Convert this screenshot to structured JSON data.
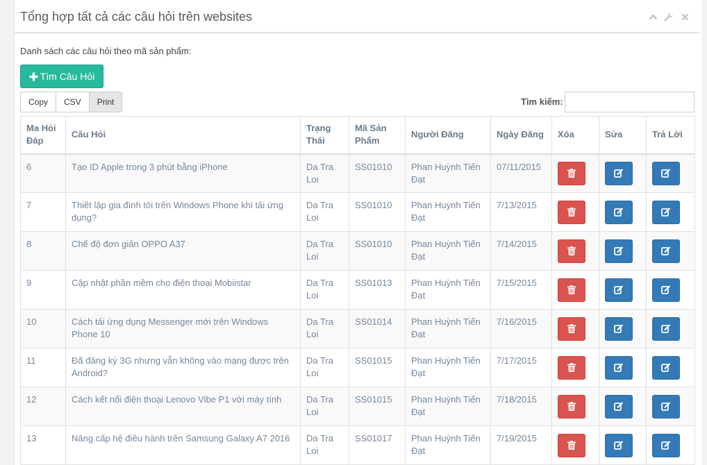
{
  "panel": {
    "title": "Tổng hợp tất cả các câu hỏi trên websites",
    "tools": [
      {
        "icon": "chevron-up-icon",
        "glyph": "⌃"
      },
      {
        "icon": "wrench-icon",
        "glyph": "🔧"
      },
      {
        "icon": "close-icon",
        "glyph": "✕"
      }
    ]
  },
  "subtitle": "Danh sách các câu hỏi theo mã sản phẩm:",
  "find_button": {
    "icon": "plus-icon",
    "label": "Tìm Câu Hỏi"
  },
  "export_buttons": [
    "Copy",
    "CSV",
    "Print"
  ],
  "search": {
    "label": "Tìm kiếm:",
    "value": ""
  },
  "table": {
    "columns": [
      "Ma Hỏi Đáp",
      "Câu Hỏi",
      "Trạng Thái",
      "Mã Sản Phẩm",
      "Người Đăng",
      "Ngày Đăng",
      "Xóa",
      "Sửa",
      "Trả Lời"
    ],
    "rows": [
      {
        "id": "6",
        "question": "Tạo ID Apple trong 3 phút bằng iPhone",
        "status": "Da Tra Loi",
        "product": "SS01010",
        "author": "Phan Huỳnh Tiến Đạt",
        "date": "07/11/2015"
      },
      {
        "id": "7",
        "question": "Thiết lập gia đình tôi trên Windows Phone khi tải ứng dụng?",
        "status": "Da Tra Loi",
        "product": "SS01010",
        "author": "Phan Huỳnh Tiến Đạt",
        "date": "7/13/2015"
      },
      {
        "id": "8",
        "question": "Chế độ đơn giản OPPO A37",
        "status": "Da Tra Loi",
        "product": "SS01010",
        "author": "Phan Huỳnh Tiến Đạt",
        "date": "7/14/2015"
      },
      {
        "id": "9",
        "question": "Cập nhật phần mềm cho điện thoại Mobiistar",
        "status": "Da Tra Loi",
        "product": "SS01013",
        "author": "Phan Huỳnh Tiến Đạt",
        "date": "7/15/2015"
      },
      {
        "id": "10",
        "question": "Cách tải ứng dụng Messenger mới trên Windows Phone 10",
        "status": "Da Tra Loi",
        "product": "SS01014",
        "author": "Phan Huỳnh Tiến Đạt",
        "date": "7/16/2015"
      },
      {
        "id": "11",
        "question": "Đã đăng ký 3G nhưng vẫn không vào mạng được trên Android?",
        "status": "Da Tra Loi",
        "product": "SS01015",
        "author": "Phan Huỳnh Tiến Đạt",
        "date": "7/17/2015"
      },
      {
        "id": "12",
        "question": "Cách kết nối điện thoại Lenovo Vibe P1 với máy tính",
        "status": "Da Tra Loi",
        "product": "SS01015",
        "author": "Phan Huỳnh Tiến Đạt",
        "date": "7/18/2015"
      },
      {
        "id": "13",
        "question": "Nâng cấp hệ điều hành trên Samsung Galaxy A7 2016",
        "status": "Da Tra Loi",
        "product": "SS01017",
        "author": "Phan Huỳnh Tiến Đạt",
        "date": "7/19/2015"
      }
    ]
  },
  "colors": {
    "success": "#26b99a",
    "danger": "#d9534f",
    "primary": "#337ab7",
    "text_muted": "#73879c"
  }
}
